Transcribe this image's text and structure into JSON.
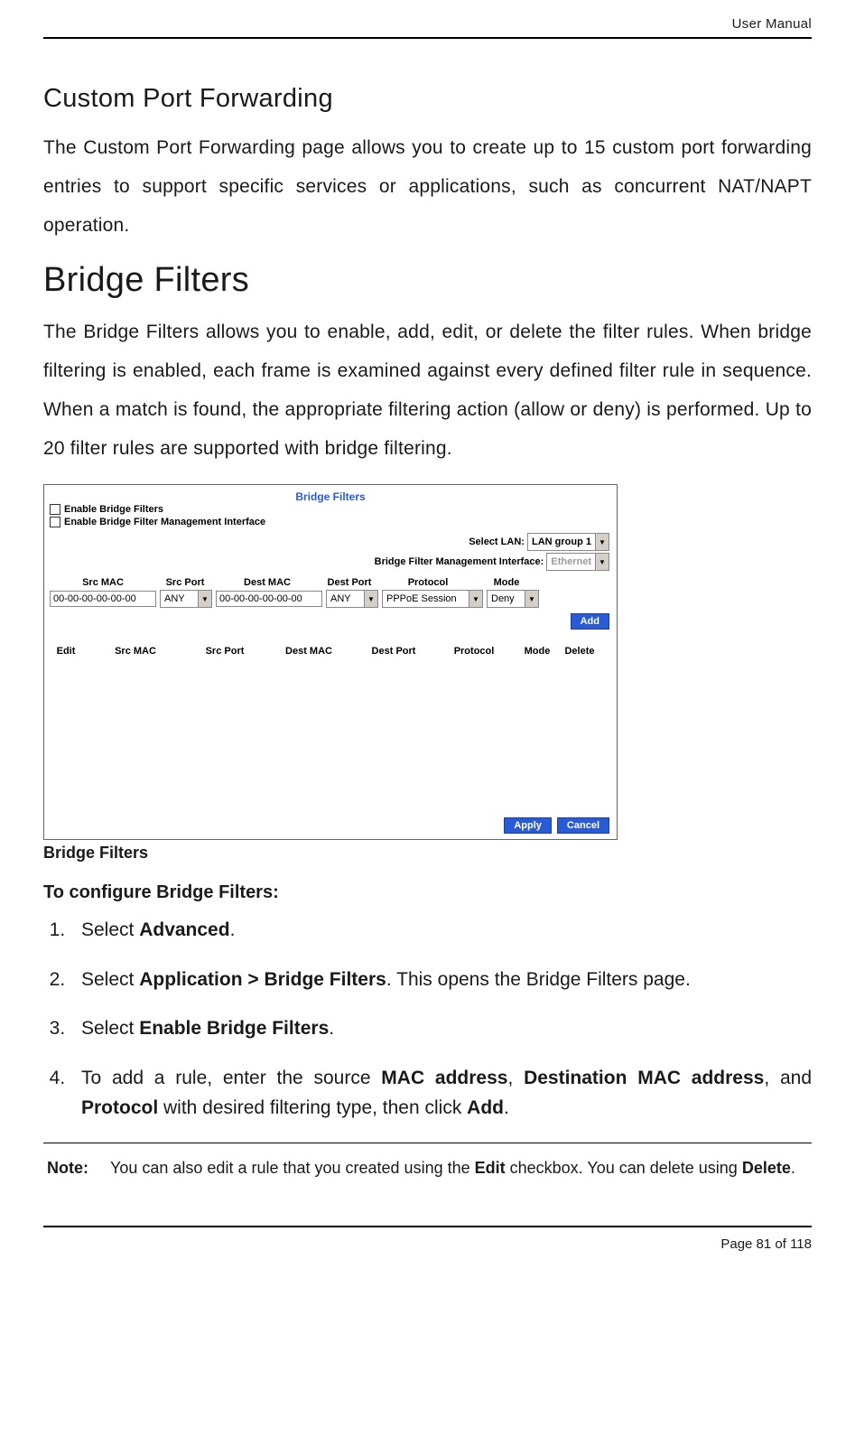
{
  "header": {
    "doc_title": "User Manual"
  },
  "sections": {
    "custom_port_forwarding": {
      "title": "Custom Port Forwarding",
      "body": "The Custom Port Forwarding page allows you to create up to 15 custom port forwarding entries to support specific services or applications, such as concurrent NAT/NAPT operation."
    },
    "bridge_filters": {
      "title": "Bridge Filters",
      "body": "The Bridge Filters allows you to enable, add, edit, or delete the filter rules. When bridge filtering is enabled, each frame is examined against every defined filter rule in sequence. When a match is found, the appropriate filtering action (allow or deny) is performed. Up to 20 filter rules are supported with bridge filtering."
    }
  },
  "screenshot": {
    "title": "Bridge Filters",
    "checkboxes": {
      "enable_bridge_filters": "Enable Bridge Filters",
      "enable_bf_mgmt_iface": "Enable Bridge Filter Management Interface"
    },
    "labels": {
      "select_lan": "Select LAN:",
      "bf_mgmt_iface": "Bridge Filter Management Interface:"
    },
    "selects": {
      "lan_value": "LAN group 1",
      "iface_value": "Ethernet"
    },
    "columns1": {
      "src_mac": "Src MAC",
      "src_port": "Src Port",
      "dest_mac": "Dest MAC",
      "dest_port": "Dest Port",
      "protocol": "Protocol",
      "mode": "Mode"
    },
    "row": {
      "src_mac": "00-00-00-00-00-00",
      "src_port": "ANY",
      "dest_mac": "00-00-00-00-00-00",
      "dest_port": "ANY",
      "protocol": "PPPoE Session",
      "mode": "Deny"
    },
    "buttons": {
      "add": "Add",
      "apply": "Apply",
      "cancel": "Cancel"
    },
    "columns2": {
      "edit": "Edit",
      "src_mac": "Src MAC",
      "src_port": "Src Port",
      "dest_mac": "Dest MAC",
      "dest_port": "Dest Port",
      "protocol": "Protocol",
      "mode": "Mode",
      "delete": "Delete"
    }
  },
  "caption": "Bridge Filters",
  "configure": {
    "heading": "To configure Bridge Filters:",
    "steps": {
      "s1a": "Select ",
      "s1b": "Advanced",
      "s1c": ".",
      "s2a": "Select ",
      "s2b": "Application > Bridge Filters",
      "s2c": ". This opens the Bridge Filters page.",
      "s3a": "Select ",
      "s3b": "Enable Bridge Filters",
      "s3c": ".",
      "s4a": "To add a rule, enter the source ",
      "s4b": "MAC address",
      "s4c": ", ",
      "s4d": "Destination MAC address",
      "s4e": ", and ",
      "s4f": "Protocol",
      "s4g": " with desired filtering type, then click ",
      "s4h": "Add",
      "s4i": "."
    }
  },
  "note": {
    "label": "Note:",
    "t1": "You can also edit a rule that you created using the ",
    "t2": "Edit",
    "t3": " checkbox. You can delete using ",
    "t4": "Delete",
    "t5": "."
  },
  "footer": {
    "page_text": "Page 81 of 118"
  }
}
